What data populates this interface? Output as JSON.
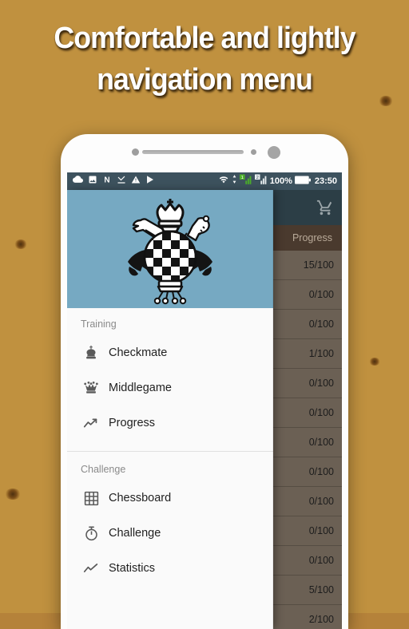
{
  "promo": {
    "headline_line1": "Comfortable and lightly",
    "headline_line2": "navigation menu"
  },
  "colors": {
    "wood": "#c0913f",
    "statusbar": "#3d525e",
    "toolbar": "#2c3e46",
    "drawer_header": "#76a9c2",
    "drawer_bg": "#fafafa",
    "row_bg": "#6b6054",
    "column_header_bg": "#4a3a2e",
    "signal_green": "#4caf2a"
  },
  "statusbar": {
    "left_icons": [
      "cloud-icon",
      "photo-icon",
      "letter-n-icon",
      "download-check-icon",
      "warning-triangle-icon",
      "play-store-icon"
    ],
    "right_icons": [
      "wifi-icon",
      "data-transfer-icon",
      "sim1-signal-icon",
      "sim2-signal-icon",
      "battery-icon"
    ],
    "sim1_label": "1",
    "sim2_label": "2",
    "battery_percent": "100%",
    "clock": "23:50"
  },
  "app": {
    "toolbar_icon": "shopping-cart-icon",
    "column_header": "Progress",
    "rows": [
      {
        "progress": "15/100"
      },
      {
        "progress": "0/100"
      },
      {
        "progress": "0/100"
      },
      {
        "progress": "1/100"
      },
      {
        "progress": "0/100"
      },
      {
        "progress": "0/100"
      },
      {
        "progress": "0/100"
      },
      {
        "progress": "0/100"
      },
      {
        "progress": "0/100"
      },
      {
        "progress": "0/100"
      },
      {
        "progress": "0/100"
      },
      {
        "progress": "5/100"
      },
      {
        "progress": "2/100"
      }
    ]
  },
  "drawer": {
    "header_image": "chess-emblem-logo",
    "sections": [
      {
        "label": "Training",
        "items": [
          {
            "label": "Checkmate",
            "icon": "chess-king-icon"
          },
          {
            "label": "Middlegame",
            "icon": "chess-queen-icon"
          },
          {
            "label": "Progress",
            "icon": "trending-up-icon"
          }
        ]
      },
      {
        "label": "Challenge",
        "items": [
          {
            "label": "Chessboard",
            "icon": "grid-board-icon"
          },
          {
            "label": "Challenge",
            "icon": "stopwatch-icon"
          },
          {
            "label": "Statistics",
            "icon": "line-chart-icon"
          }
        ]
      }
    ]
  }
}
